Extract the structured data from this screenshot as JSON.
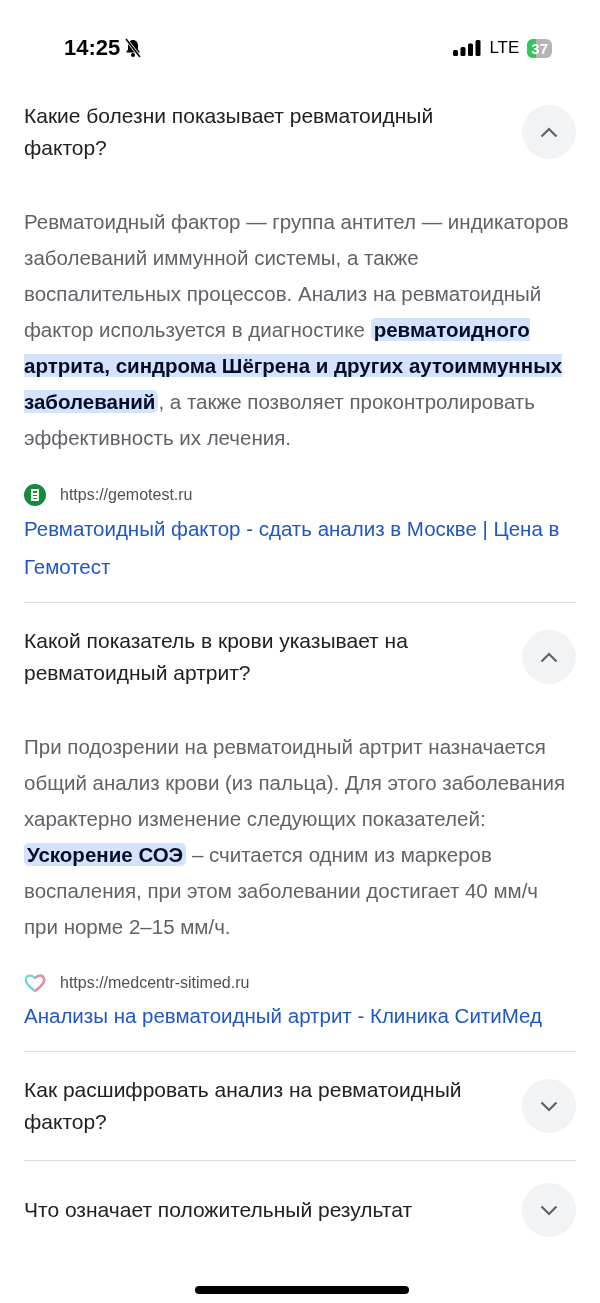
{
  "status_bar": {
    "time": "14:25",
    "network": "LTE",
    "battery": "37"
  },
  "faq": [
    {
      "question": "Какие болезни показывает ревматоидный фактор?",
      "expanded": true,
      "answer": "Ревматоидный фактор — группа антител — индикаторов заболеваний иммунной системы, а также воспалительных процессов. Анализ на ревматоидный фактор используется в диагностике **ревматоидного артрита, синдрома Шёгрена и других аутоиммунных заболеваний**, а также позволяет проконтролировать эффективность их лечения.",
      "source": {
        "kind": "gemotest",
        "url": "https://gemotest.ru"
      },
      "link": "Ревматоидный фактор - сдать анализ в Москве | Цена в Гемотест"
    },
    {
      "question": "Какой показатель в крови указывает на ревматоидный артрит?",
      "expanded": true,
      "answer": "При подозрении на ревматоидный артрит назначается общий анализ крови (из пальца). Для этого заболевания характерно изменение следующих показателей: **Ускорение СОЭ** – считается одним из маркеров воспаления, при этом заболевании достигает 40 мм/ч при норме 2–15 мм/ч.",
      "source": {
        "kind": "heart",
        "url": "https://medcentr-sitimed.ru"
      },
      "link": "Анализы на ревматоидный артрит - Клиника СитиМед"
    },
    {
      "question": "Как расшифровать анализ на ревматоидный фактор?",
      "expanded": false
    },
    {
      "question": "Что означает положительный результат",
      "expanded": false
    }
  ]
}
